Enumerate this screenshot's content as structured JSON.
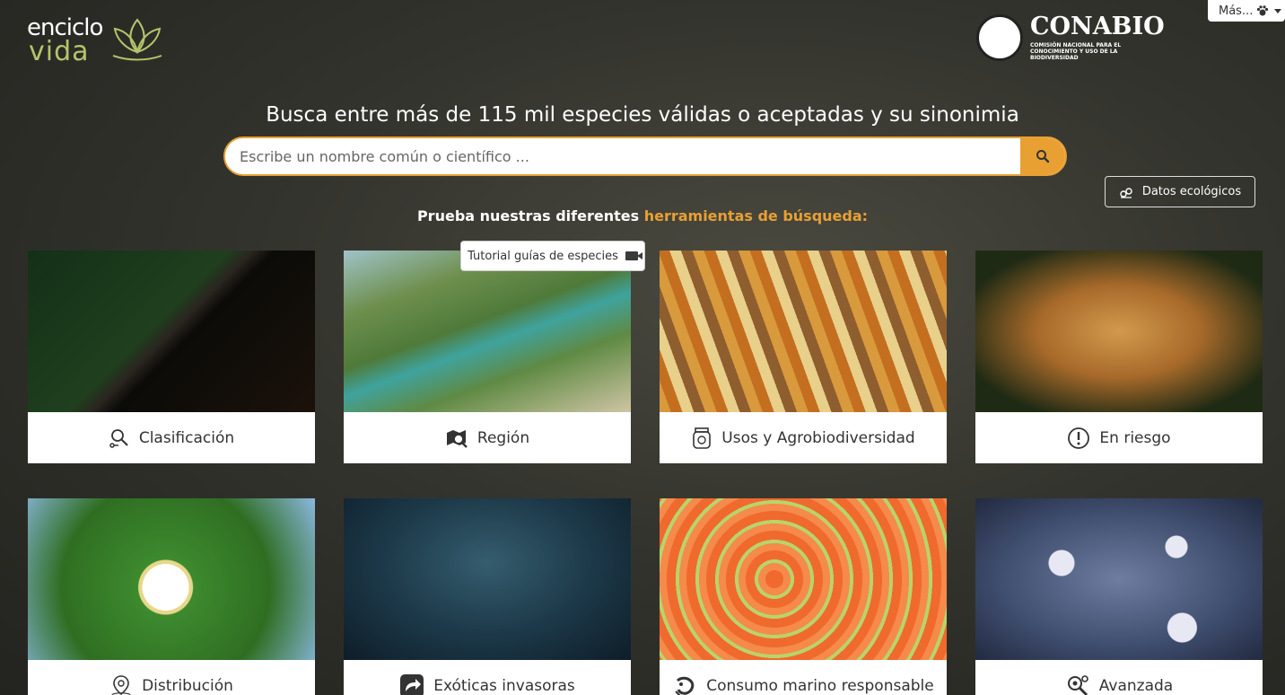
{
  "header": {
    "logo_left": {
      "line1": "enciclo",
      "line2": "vida"
    },
    "logo_right": {
      "name": "CONABIO",
      "sub": "COMISIÓN NACIONAL PARA EL CONOCIMIENTO Y USO DE LA BIODIVERSIDAD"
    },
    "more_label": "Más..."
  },
  "headline": "Busca entre más de 115 mil especies válidas o aceptadas y su sinonimia",
  "search": {
    "placeholder": "Escribe un nombre común o científico ..."
  },
  "datos_button": "Datos ecológicos",
  "tagline": {
    "prefix": "Prueba nuestras diferentes",
    "highlight": "herramientas de búsqueda:"
  },
  "tooltip": "Tutorial guías de especies",
  "cards": [
    {
      "label": "Clasificación",
      "icon": "taxonomy-icon"
    },
    {
      "label": "Región",
      "icon": "map-search-icon"
    },
    {
      "label": "Usos y Agrobiodiversidad",
      "icon": "jar-icon"
    },
    {
      "label": "En riesgo",
      "icon": "alert-icon"
    },
    {
      "label": "Distribución",
      "icon": "location-pin-icon"
    },
    {
      "label": "Exóticas invasoras",
      "icon": "invasive-arrow-icon"
    },
    {
      "label": "Consumo marino responsable",
      "icon": "marine-icon"
    },
    {
      "label": "Avanzada",
      "icon": "advanced-search-icon"
    }
  ],
  "colors": {
    "accent": "#e8a033",
    "logo_green": "#b5c46a"
  }
}
